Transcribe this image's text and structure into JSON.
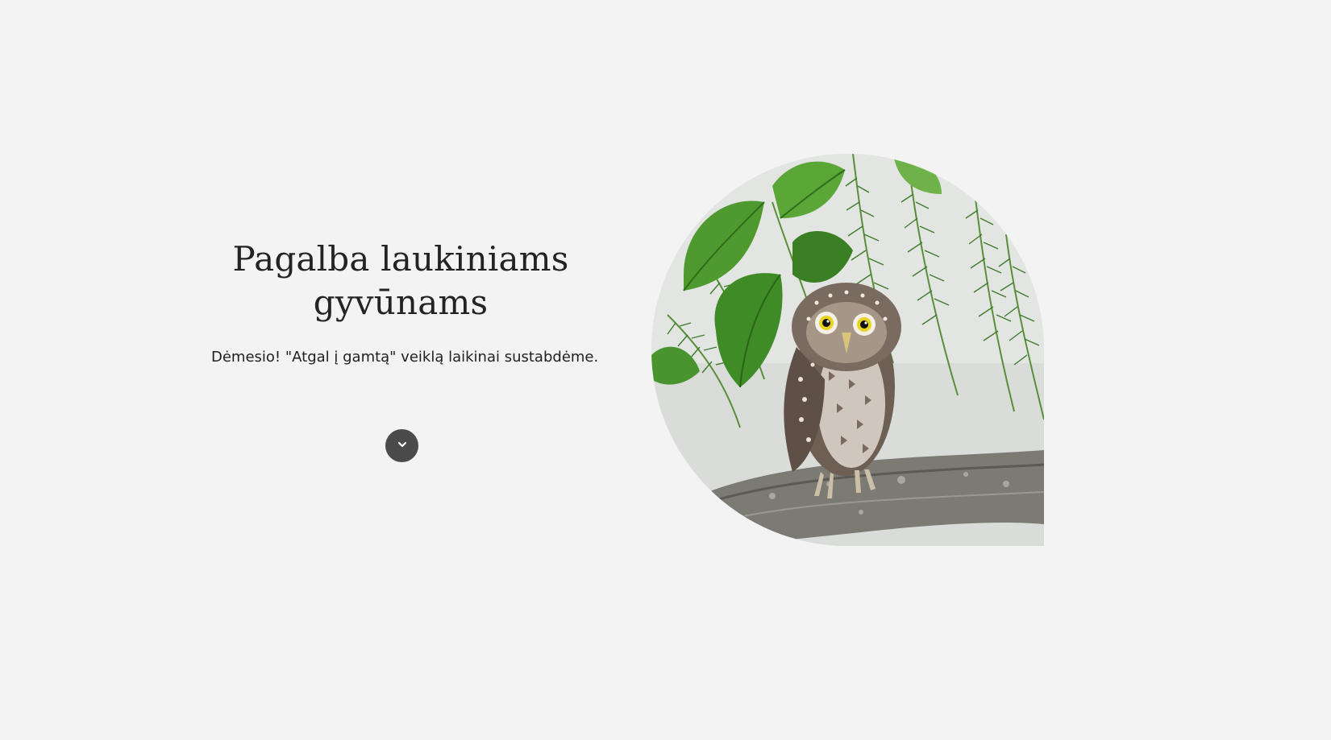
{
  "hero": {
    "title": "Pagalba laukiniams gyvūnams",
    "notice": "Dėmesio! \"Atgal į gamtą\" veiklą laikinai sustabdėme.",
    "scroll_icon": "chevron-down-icon",
    "image_subject": "owl-photo"
  },
  "colors": {
    "background": "#f2f3f2",
    "title": "#232323",
    "button": "#4b4b4b"
  }
}
